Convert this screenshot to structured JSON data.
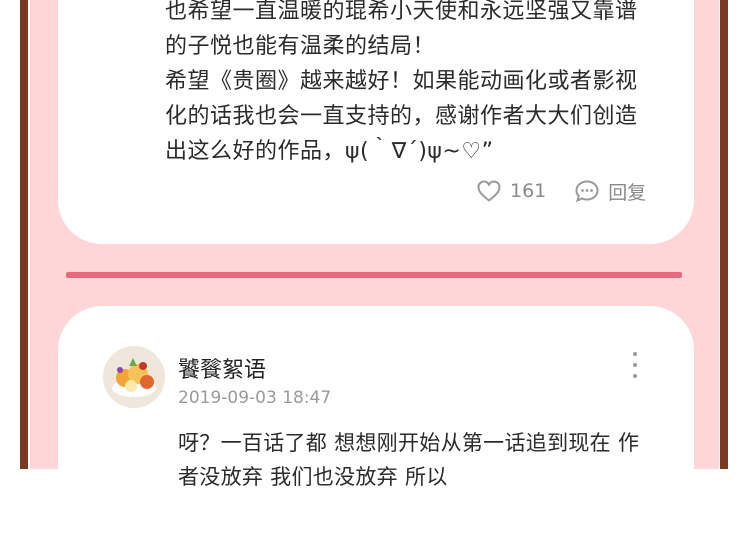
{
  "colors": {
    "frame": "#7a3a22",
    "panel": "#ffd6d8",
    "divider": "#e56b7d",
    "card": "#ffffff"
  },
  "comment_top": {
    "lines": [
      "也希望一直温暖的琨希小天使和永远坚强又靠谱",
      "的子悦也能有温柔的结局！",
      "希望《贵圈》越来越好！如果能动画化或者影视",
      "化的话我也会一直支持的，感谢作者大大们创造",
      "出这么好的作品，ψ(｀∇´)ψ~♡”"
    ],
    "like_count": "161",
    "reply_label": "回复",
    "icons": {
      "like": "heart-outline-icon",
      "reply": "chat-bubble-icon"
    }
  },
  "comment_bottom": {
    "username": "饕餮絮语",
    "timestamp": "2019-09-03 18:47",
    "lines": [
      "呀？一百话了都 想想刚开始从第一话追到现在 作",
      "者没放弃 我们也没放弃 所以"
    ],
    "icons": {
      "more": "more-vertical-icon"
    }
  }
}
